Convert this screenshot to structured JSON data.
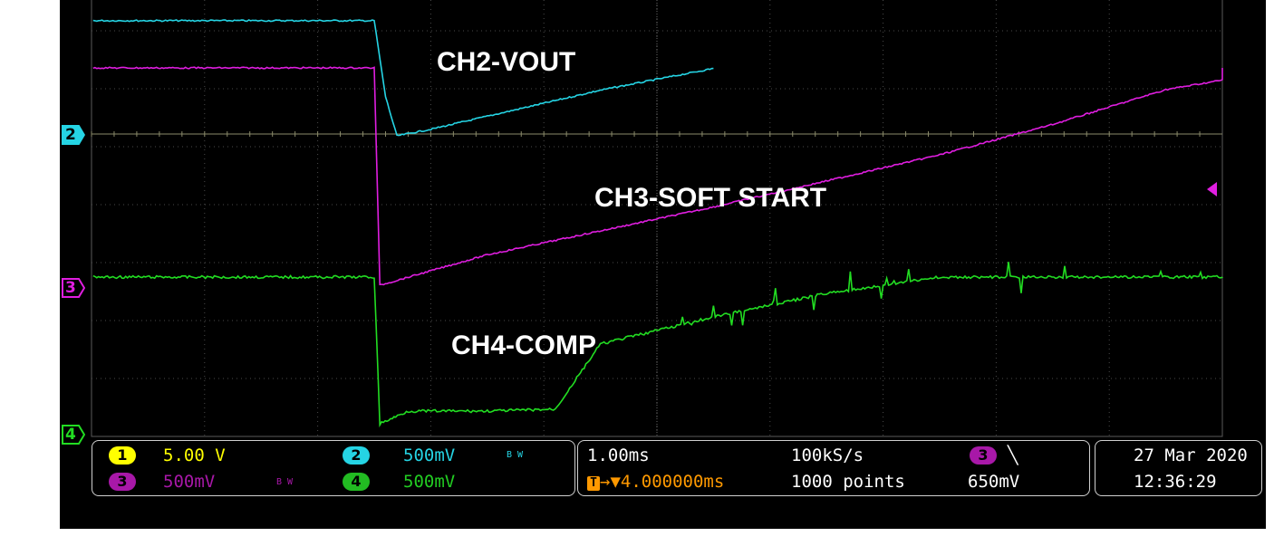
{
  "chart_data": {
    "type": "line",
    "series": [
      {
        "name": "CH2-VOUT",
        "color": "#25d4e4",
        "x": [
          -5.0,
          -0.1,
          0.0,
          0.1,
          0.2,
          0.5,
          1.0,
          1.5,
          2.0,
          2.5,
          3.0
        ],
        "y": [
          5.3,
          5.3,
          5.3,
          1.8,
          0.0,
          0.3,
          0.9,
          1.5,
          2.1,
          2.6,
          3.1
        ]
      },
      {
        "name": "CH3-SOFT START",
        "color": "#e01ee0",
        "x": [
          -5.0,
          -0.1,
          0.0,
          0.05,
          1.0,
          3.0,
          5.0,
          6.0,
          7.0,
          8.0,
          9.0,
          10.0
        ],
        "y": [
          2.5,
          2.5,
          2.5,
          0.0,
          0.35,
          0.9,
          1.5,
          1.85,
          2.25,
          2.47,
          2.52,
          2.5
        ]
      },
      {
        "name": "CH4-COMP",
        "color": "#22dd22",
        "x": [
          -5.0,
          -0.1,
          0.0,
          0.05,
          0.3,
          1.0,
          1.6,
          2.0,
          3.0,
          4.0,
          5.0,
          10.0
        ],
        "y": [
          4.05,
          4.05,
          4.05,
          0.0,
          0.35,
          0.35,
          0.4,
          2.2,
          2.95,
          3.6,
          4.05,
          4.05
        ]
      }
    ],
    "annotations": [
      "CH2-VOUT",
      "CH3-SOFT START",
      "CH4-COMP"
    ],
    "grid": true
  },
  "markers": {
    "ch2": "2",
    "ch3": "3",
    "ch4": "4"
  },
  "status": {
    "ch1": {
      "num": "1",
      "scale": "5.00 V",
      "color": "#ffff00"
    },
    "ch2": {
      "num": "2",
      "scale": "500mV",
      "bw": "B W",
      "color": "#25d4e4"
    },
    "ch3": {
      "num": "3",
      "scale": "500mV",
      "bw": "B W",
      "color": "#b01ab0"
    },
    "ch4": {
      "num": "4",
      "scale": "500mV",
      "color": "#22cc22"
    },
    "timebase": "1.00ms",
    "sample_rate": "100kS/s",
    "points": "1000 points",
    "trigger_delay": "→▼4.000000ms",
    "trigger_source": "3",
    "trigger_slope": "╲",
    "trigger_level": "650mV",
    "date": "27 Mar  2020",
    "time": "12:36:29"
  }
}
